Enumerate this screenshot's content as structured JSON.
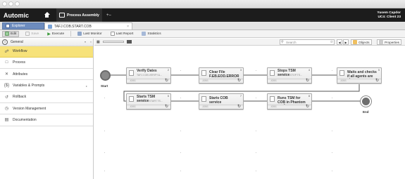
{
  "top": {
    "logo": "Automic",
    "tab": "Process Assembly",
    "plus": "+–",
    "user_line1": "Yusem Capdor",
    "user_line2": "UC4: Client 23"
  },
  "tabs": {
    "explorer": "Explorer",
    "object": "TAFJ.COB.START.COB",
    "close": "×"
  },
  "toolbar": {
    "edit": "Edit",
    "save": "Save",
    "execute": "Execute",
    "last_monitor": "Last Monitor",
    "last_report": "Last Report",
    "statistics": "Statistics"
  },
  "sidebar": {
    "general": "General",
    "items": [
      {
        "label": "Workflow",
        "icon": "workflow-icon",
        "active": true
      },
      {
        "label": "Process",
        "icon": "process-icon"
      },
      {
        "label": "Attributes",
        "icon": "attributes-icon"
      },
      {
        "label": "Variables & Prompts",
        "icon": "variables-icon",
        "arrow": true
      },
      {
        "label": "Rollback",
        "icon": "rollback-icon"
      },
      {
        "label": "Version Management",
        "icon": "clock-icon"
      },
      {
        "label": "Documentation",
        "icon": "documentation-icon"
      }
    ]
  },
  "canvas": {
    "search_placeholder": "Search",
    "objects": "Objects",
    "properties": "Properties",
    "start": "Start",
    "end": "End",
    "nodes": [
      {
        "num": "2",
        "name": "Verify Dates",
        "sub": "TAFJ.COB.VERIFY.&...",
        "type": "JOBS"
      },
      {
        "num": "3",
        "name": "Clear File F.EB.EOD.ERROR",
        "sub": "",
        "type": "JOBS"
      },
      {
        "num": "4",
        "name": "Stops TSM service",
        "sub": "TAFJ.COB.STOP.TS...",
        "type": "JOBS"
      },
      {
        "num": "5",
        "name": "Waits and checks if all agents are st...",
        "sub": "",
        "type": "JOBS"
      },
      {
        "num": "6",
        "name": "Starts TSM service",
        "sub": "TAFJ.COB.START.TS...",
        "type": "JOBS"
      },
      {
        "num": "7",
        "name": "Starts COB service",
        "sub": "",
        "type": "JOBS"
      },
      {
        "num": "8",
        "name": "Runs TSM for COB in Phantom mode",
        "sub": "",
        "type": "JOBS"
      }
    ]
  },
  "colors": {
    "top": "#1c1c1c",
    "explorer_tab": "#6d8cbe",
    "active_nav": "#f7e27a",
    "start_circle": "#8a8a8a",
    "end_circle": "#7a7a7a"
  }
}
